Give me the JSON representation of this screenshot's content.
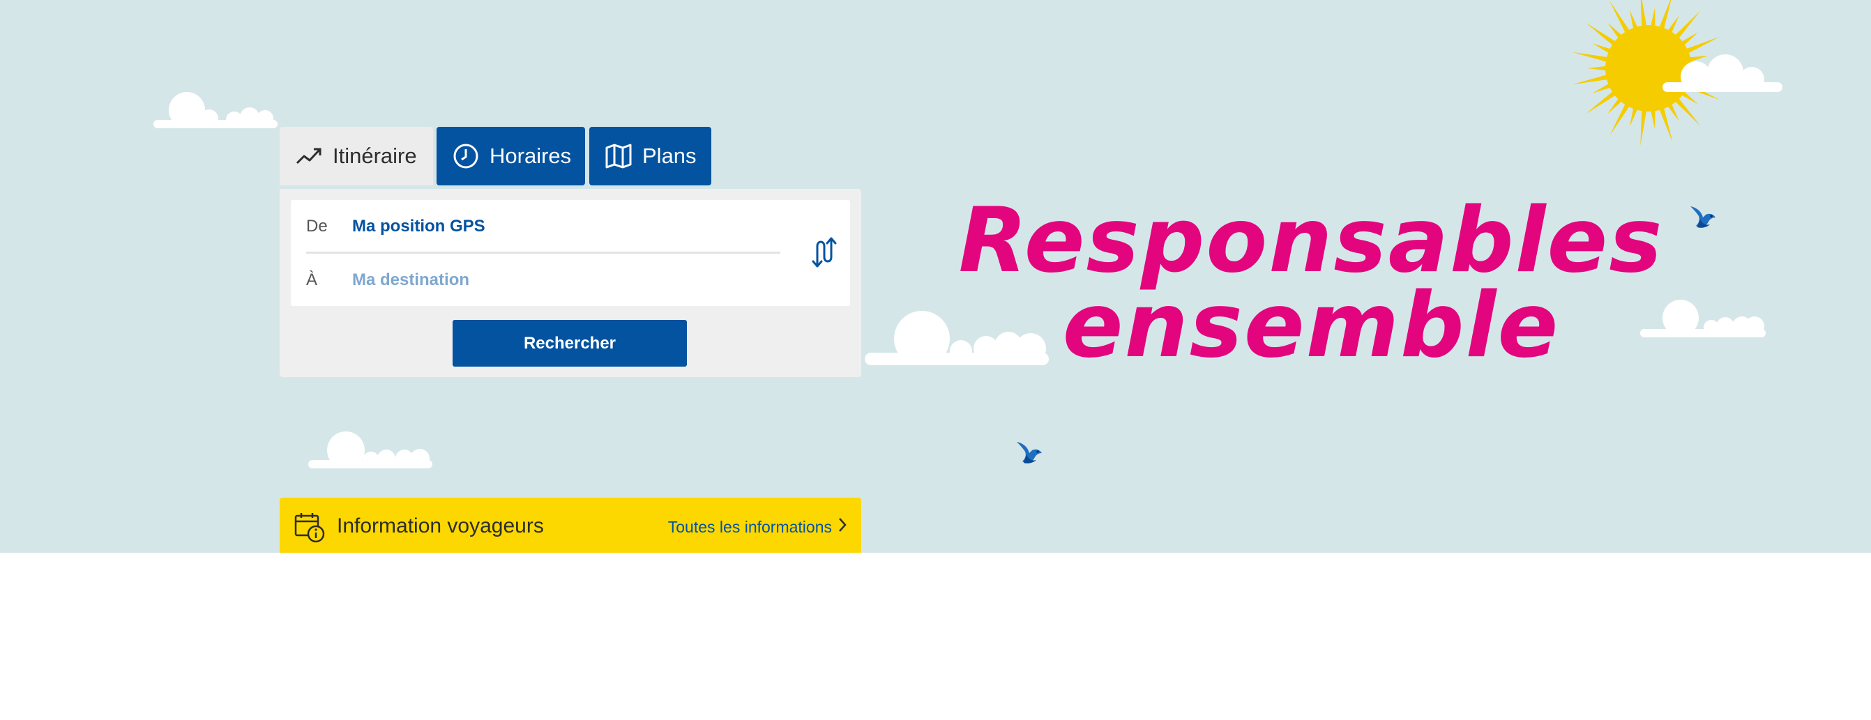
{
  "tabs": [
    {
      "label": "Itinéraire",
      "icon": "trend-line-icon",
      "active": true
    },
    {
      "label": "Horaires",
      "icon": "clock-icon",
      "active": false
    },
    {
      "label": "Plans",
      "icon": "map-icon",
      "active": false
    }
  ],
  "search": {
    "from_label": "De",
    "from_value": "Ma position GPS",
    "to_label": "À",
    "to_placeholder": "Ma destination",
    "button_label": "Rechercher"
  },
  "hero": {
    "headline_line1": "Responsables",
    "headline_line2": "ensemble"
  },
  "info_bar": {
    "icon": "calendar-info-icon",
    "title": "Information voyageurs",
    "link_label": "Toutes les informations"
  },
  "colors": {
    "sky": "#d5e6e9",
    "brand_blue": "#0353a0",
    "headline_pink": "#e3057e",
    "info_yellow": "#fcd800",
    "sun": "#f5cc00"
  }
}
